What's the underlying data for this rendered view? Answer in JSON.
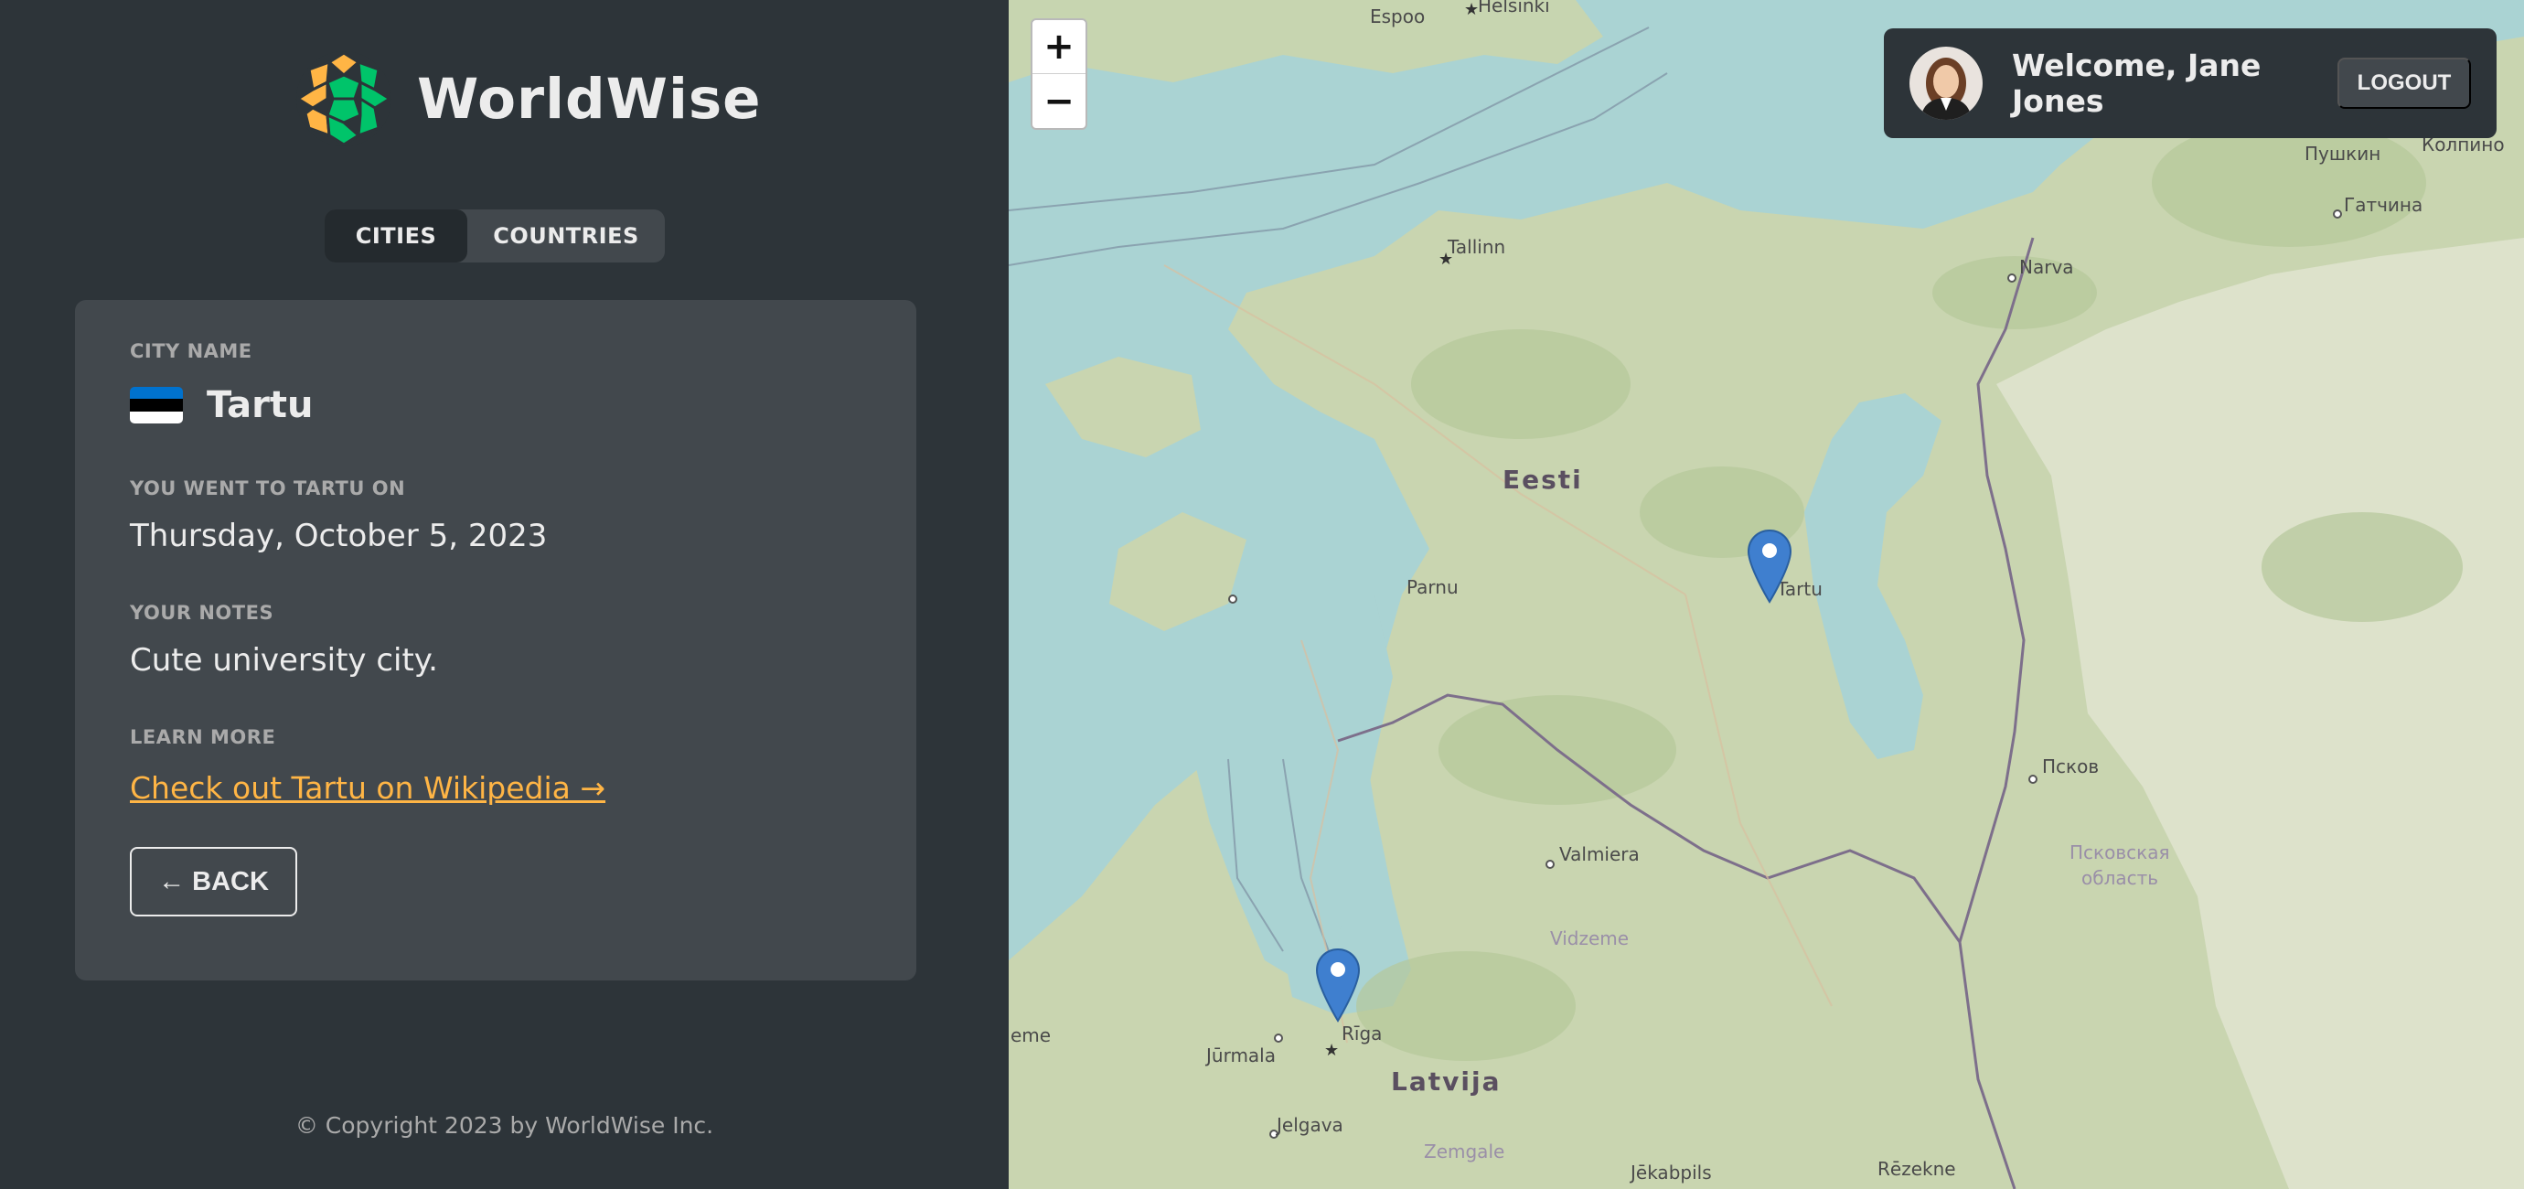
{
  "app": {
    "name": "WorldWise"
  },
  "tabs": [
    {
      "label": "CITIES",
      "active": true
    },
    {
      "label": "COUNTRIES",
      "active": false
    }
  ],
  "city": {
    "name_label": "City name",
    "name": "Tartu",
    "flag_colors": [
      "#0072ce",
      "#000000",
      "#ffffff"
    ],
    "date_label": "You went to Tartu on",
    "date": "Thursday, October 5, 2023",
    "notes_label": "Your notes",
    "notes": "Cute university city.",
    "learn_label": "Learn more",
    "wiki_link": "Check out Tartu on Wikipedia →",
    "back_label": "← BACK"
  },
  "footer": {
    "copyright": "© Copyright 2023 by WorldWise Inc."
  },
  "map": {
    "zoom_in": "+",
    "zoom_out": "−",
    "labels": {
      "espoo": "Espoo",
      "helsinki": "Helsinki",
      "tallinn": "Tallinn",
      "narva": "Narva",
      "pushkin": "Пушкин",
      "kolpino": "Колпино",
      "gatchina": "Гатчина",
      "eesti": "Eesti",
      "parnu": "Parnu",
      "tartu": "Tartu",
      "pskov": "Псков",
      "pskov_oblast_1": "Псковская",
      "pskov_oblast_2": "область",
      "valmiera": "Valmiera",
      "vidzeme": "Vidzeme",
      "riga": "Rīga",
      "jurmala": "Jūrmala",
      "eme": "eme",
      "latvija": "Latvija",
      "jelgava": "Jelgava",
      "zemgale": "Zemgale",
      "jekabpils": "Jēkabpils",
      "rezekne": "Rēzekne"
    },
    "markers": [
      "Tartu",
      "Rīga"
    ]
  },
  "user": {
    "welcome": "Welcome, Jane Jones",
    "logout_label": "LOGOUT"
  },
  "colors": {
    "accent": "#ffb545",
    "sidebar_bg": "#2d3439",
    "card_bg": "#42484d",
    "water": "#a9d3d4",
    "land": "#c6d3ad"
  }
}
